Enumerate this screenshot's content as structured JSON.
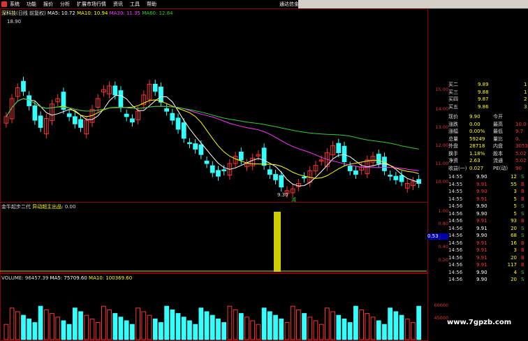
{
  "menu": {
    "items": [
      "系统",
      "功能",
      "报价",
      "分析",
      "扩展市场行情",
      "资讯",
      "工具",
      "帮助"
    ],
    "app_title": "通达信金"
  },
  "main_chart": {
    "stock_name": "深科技",
    "subtitle": "(日线 前复权)",
    "ma5": "MA5: 10.72",
    "ma10": "MA10: 10.94",
    "ma30": "MA30: 11.35",
    "ma60": "MA60: 12.84",
    "high_marker": "18.90",
    "low_marker": "9.30",
    "ticks": [
      "15.00",
      "14.00",
      "13.00",
      "12.00",
      "11.00",
      "10.00"
    ],
    "signal": "减"
  },
  "indicator": {
    "name": "金牛起步二代",
    "value": "0.00",
    "sub": "异动超主出品:",
    "sub_value": "0.00",
    "ticks": [
      "1.00",
      "0.80",
      "0.60",
      "0.40",
      "0.20"
    ],
    "current": "0.53"
  },
  "volume": {
    "label": "VOLUME: 96457.39",
    "ma5": "MA5: 75709.60",
    "ma10": "MA10: 100369.60",
    "ticks": [
      "60000",
      "45000"
    ]
  },
  "quote": {
    "asks": [
      {
        "n": "买二",
        "p": "9.89",
        "v": "1"
      },
      {
        "n": "买三",
        "p": "9.88",
        "v": "1"
      },
      {
        "n": "买四",
        "p": "9.87",
        "v": "2"
      },
      {
        "n": "买五",
        "p": "9.86",
        "v": "3"
      }
    ],
    "stats": [
      {
        "a": "现价",
        "b": "9.90",
        "c": "今开",
        "d": ""
      },
      {
        "a": "涨跌",
        "b": "0.00",
        "c": "最高",
        "d": "10.0"
      },
      {
        "a": "涨幅",
        "b": "0.00%",
        "c": "最低",
        "d": "9.7"
      },
      {
        "a": "总量",
        "b": "59249",
        "c": "量比",
        "d": "0."
      },
      {
        "a": "外盘",
        "b": "28718",
        "c": "内盘",
        "d": "3053"
      },
      {
        "a": "换手",
        "b": "1.18%",
        "c": "股本",
        "d": "5.02"
      },
      {
        "a": "净资",
        "b": "2.63",
        "c": "流通",
        "d": "5.02"
      },
      {
        "a": "收益(一)",
        "b": "0.027",
        "c": "PE(动)",
        "d": "90"
      }
    ],
    "ticks": [
      {
        "t": "14:55",
        "p": "9.90",
        "v": "12",
        "s": "S"
      },
      {
        "t": "14:55",
        "p": "9.91",
        "v": "55",
        "s": "B"
      },
      {
        "t": "14:55",
        "p": "9.90",
        "v": "3",
        "s": "B"
      },
      {
        "t": "14:55",
        "p": "9.91",
        "v": "5",
        "s": "B"
      },
      {
        "t": "14:56",
        "p": "9.90",
        "v": "5",
        "s": "S"
      },
      {
        "t": "14:56",
        "p": "9.90",
        "v": "5",
        "s": "S"
      },
      {
        "t": "14:56",
        "p": "9.91",
        "v": "93",
        "s": "B"
      },
      {
        "t": "14:56",
        "p": "9.91",
        "v": "20",
        "s": "S"
      },
      {
        "t": "14:56",
        "p": "9.90",
        "v": "68",
        "s": "S"
      },
      {
        "t": "14:56",
        "p": "9.91",
        "v": "16",
        "s": "B"
      },
      {
        "t": "14:56",
        "p": "9.91",
        "v": "3",
        "s": "B"
      },
      {
        "t": "14:56",
        "p": "9.91",
        "v": "20",
        "s": "B"
      },
      {
        "t": "14:56",
        "p": "9.91",
        "v": "117",
        "s": "B"
      },
      {
        "t": "14:56",
        "p": "9.90",
        "v": "4",
        "s": "S"
      },
      {
        "t": "14:56",
        "p": "9.90",
        "v": "20",
        "s": "S"
      }
    ]
  },
  "watermark": "www.7gpzb.com",
  "colors": {
    "up": "#ff3333",
    "down": "#33ffff",
    "ma5": "#ffffff",
    "ma10": "#ffff00",
    "ma30": "#ff33ff",
    "ma60": "#33cc33",
    "bar": "#cccc00"
  }
}
